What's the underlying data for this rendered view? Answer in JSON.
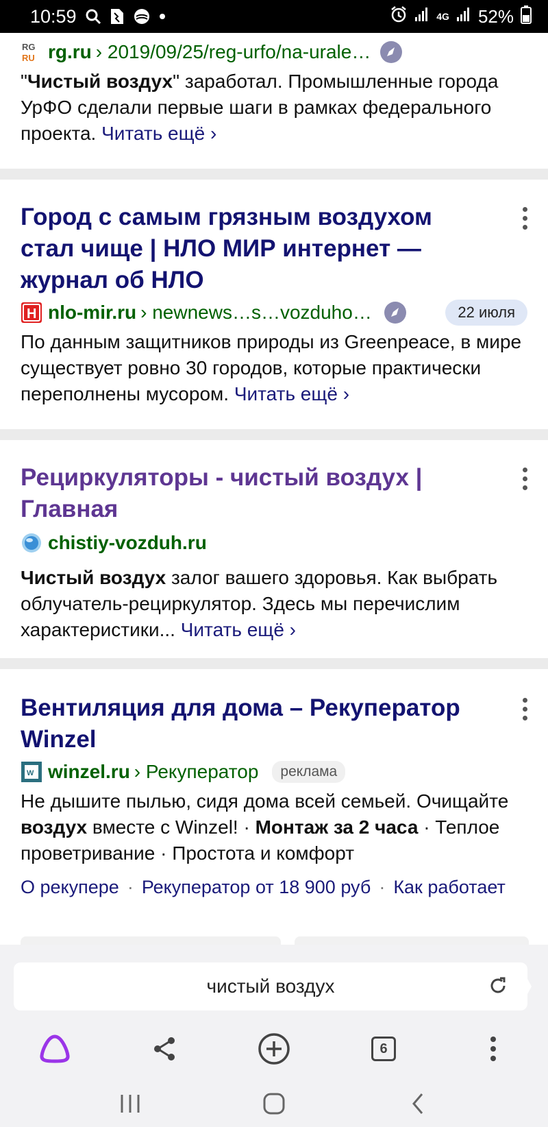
{
  "status_bar": {
    "time": "10:59",
    "battery_percent": "52%",
    "network": "4G",
    "icons": [
      "search-icon",
      "sim-icon",
      "shield-icon",
      "dot-icon",
      "alarm-icon",
      "signal-icon",
      "battery-icon"
    ]
  },
  "results": [
    {
      "host": "rg.ru",
      "path": "› 2019/09/25/reg-urfo/na-urale…",
      "favicon": "rg-favicon",
      "snippet_parts": [
        {
          "t": "\"",
          "b": false
        },
        {
          "t": "Чистый воздух",
          "b": true
        },
        {
          "t": "\" заработал. Промышленные города УрФО сделали первые шаги в рамках федерального проекта.",
          "b": false
        }
      ],
      "more": "Читать ещё ›"
    },
    {
      "title_parts": [
        {
          "t": "Город с самым грязным ",
          "b": false
        },
        {
          "t": "воздухом",
          "b": true
        },
        {
          "t": " стал ",
          "b": false
        },
        {
          "t": "чище",
          "b": true
        },
        {
          "t": " | НЛО МИР интернет — журнал об НЛО",
          "b": false
        }
      ],
      "host": "nlo-mir.ru",
      "path": "› newnews…s…vozduho…",
      "date": "22 июля",
      "favicon": "h-favicon",
      "snippet_parts": [
        {
          "t": "По данным защитников природы из Greenpeace, в мире существует ровно 30 городов, которые практически переполнены мусором.",
          "b": false
        }
      ],
      "more": "Читать ещё ›"
    },
    {
      "title_parts": [
        {
          "t": "Рециркуляторы - ",
          "b": false
        },
        {
          "t": "чистый воздух",
          "b": true
        },
        {
          "t": " | Главная",
          "b": false
        }
      ],
      "host": "chistiy-vozduh.ru",
      "favicon": "globe-favicon",
      "snippet_parts": [
        {
          "t": "Чистый воздух",
          "b": true
        },
        {
          "t": " залог вашего здоровья. Как выбрать облучатель-рециркулятор. Здесь мы перечислим характеристики...",
          "b": false
        }
      ],
      "more": "Читать ещё ›"
    },
    {
      "title_parts": [
        {
          "t": "Вентиляция для дома – Рекуператор Winzel",
          "b": false
        }
      ],
      "host": "winzel.ru",
      "path": "› Рекуператор",
      "ad_label": "реклама",
      "favicon": "winzel-favicon",
      "snippet_parts": [
        {
          "t": "Не дышите пылью, сидя дома всей семьей. Очищайте ",
          "b": false
        },
        {
          "t": "воздух",
          "b": true
        },
        {
          "t": " вместе с Winzel! · ",
          "b": false
        },
        {
          "t": "Монтаж за 2 часа",
          "b": true
        },
        {
          "t": " · Теплое проветривание · Простота и комфорт",
          "b": false
        }
      ],
      "sitelinks": [
        "О рекупере",
        "Рекуператор от 18 900 руб",
        "Как работает"
      ]
    }
  ],
  "search": {
    "query": "чистый воздух"
  },
  "toolbar": {
    "tabs_count": "6",
    "icons": [
      "alice-icon",
      "share-icon",
      "new-tab-icon",
      "tabs-icon",
      "more-icon"
    ]
  },
  "nav": {
    "icons": [
      "recent-apps-icon",
      "home-icon",
      "back-icon"
    ]
  },
  "colors": {
    "title": "#131371",
    "visited_title": "#5e3692",
    "url_green": "#006000",
    "alice_purple": "#9b35e8"
  }
}
